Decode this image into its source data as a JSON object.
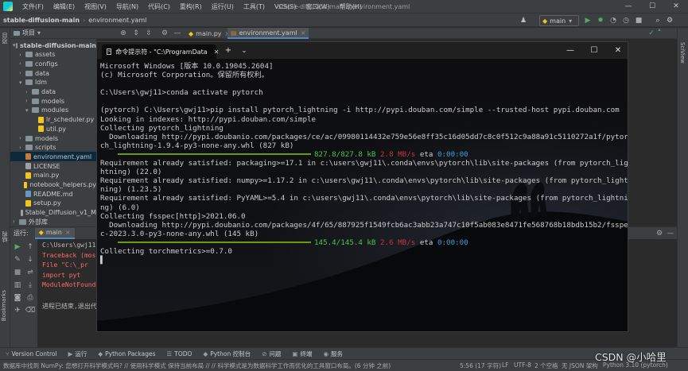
{
  "menubar": {
    "items": [
      "文件(F)",
      "编辑(E)",
      "视图(V)",
      "导航(N)",
      "代码(C)",
      "重构(R)",
      "运行(U)",
      "工具(T)",
      "VCS(S)",
      "窗口(W)",
      "帮助(H)"
    ],
    "window_title": "stable-diffusion-main - environment.yaml",
    "minimize": "—",
    "maximize": "☐",
    "close": "✕"
  },
  "navbar": {
    "project": "stable-diffusion-main",
    "file": "environment.yaml",
    "run_config": "main"
  },
  "tool_strips": {
    "project_tab": "项目",
    "structure_tab": "结构",
    "bookmarks_tab": "Bookmarks",
    "sciview_tab": "SciView"
  },
  "project_panel": {
    "header": "项目",
    "items": [
      {
        "label": "stable-diffusion-main",
        "kind": "root"
      },
      {
        "label": "assets",
        "kind": "folder"
      },
      {
        "label": "configs",
        "kind": "folder"
      },
      {
        "label": "data",
        "kind": "folder"
      },
      {
        "label": "ldm",
        "kind": "folder"
      },
      {
        "label": "data",
        "kind": "folder"
      },
      {
        "label": "models",
        "kind": "folder"
      },
      {
        "label": "modules",
        "kind": "folder"
      },
      {
        "label": "lr_scheduler.py",
        "kind": "py"
      },
      {
        "label": "util.py",
        "kind": "py"
      },
      {
        "label": "models",
        "kind": "folder"
      },
      {
        "label": "scripts",
        "kind": "folder"
      },
      {
        "label": "environment.yaml",
        "kind": "yaml"
      },
      {
        "label": "LICENSE",
        "kind": "txt"
      },
      {
        "label": "main.py",
        "kind": "py"
      },
      {
        "label": "notebook_helpers.py",
        "kind": "py"
      },
      {
        "label": "README.md",
        "kind": "md"
      },
      {
        "label": "setup.py",
        "kind": "py"
      },
      {
        "label": "Stable_Diffusion_v1_M",
        "kind": "txt"
      },
      {
        "label": "外部库",
        "kind": "lib"
      }
    ]
  },
  "editor_tabs": [
    {
      "label": "main.py"
    },
    {
      "label": "environment.yaml"
    }
  ],
  "run_panel": {
    "label": "运行:",
    "tab": "main",
    "lines": [
      {
        "text": "C:\\Users\\gwj11",
        "color": "#bbbbbb"
      },
      {
        "text": "Traceback (mos",
        "color": "#ff6b68"
      },
      {
        "text": "  File \"C:\\_pr",
        "color": "#ff6b68"
      },
      {
        "text": "    import pyt",
        "color": "#ff6b68"
      },
      {
        "text": "ModuleNotFoundE",
        "color": "#ff6b68"
      },
      {
        "text": "",
        "color": "#bbbbbb"
      },
      {
        "text": "进程已结束,退出代",
        "color": "#bbbbbb"
      }
    ]
  },
  "terminal": {
    "tab_title": "命令提示符 - \"C:\\ProgramData",
    "new_tab": "+",
    "dropdown": "⌄",
    "lines": [
      "Microsoft Windows [版本 10.0.19045.2604]",
      "(c) Microsoft Corporation。保留所有权利。",
      "",
      "C:\\Users\\gwj11>conda activate pytorch",
      "",
      "(pytorch) C:\\Users\\gwj11>pip install pytorch_lightning -i http://pypi.douban.com/simple --trusted-host pypi.douban.com",
      "Looking in indexes: http://pypi.douban.com/simple",
      "Collecting pytorch_lightning",
      "  Downloading http://pypi.doubanio.com/packages/ce/ac/09980114432e759e56e8ff35c16d05dd7c8c0f512c9a88a91c5110272a1f/pytor",
      "ch_lightning-1.9.4-py3-none-any.whl (827 kB)"
    ],
    "progress1": {
      "fraction": 1.0,
      "done": "827.8/827.8 kB",
      "speed": "2.8 MB/s",
      "eta_label": "eta",
      "eta": "0:00:00"
    },
    "lines2": [
      "Requirement already satisfied: packaging>=17.1 in c:\\users\\gwj11\\.conda\\envs\\pytorch\\lib\\site-packages (from pytorch_lig",
      "htning) (22.0)",
      "Requirement already satisfied: numpy>=1.17.2 in c:\\users\\gwj11\\.conda\\envs\\pytorch\\lib\\site-packages (from pytorch_light",
      "ning) (1.23.5)",
      "Requirement already satisfied: PyYAML>=5.4 in c:\\users\\gwj11\\.conda\\envs\\pytorch\\lib\\site-packages (from pytorch_lightni",
      "ng) (6.0)",
      "Collecting fsspec[http]>2021.06.0",
      "  Downloading http://pypi.doubanio.com/packages/4f/65/887925f1549fcb6ac3abb23a747c10f5ab083e8471fe568768b18bdb15b2/fsspe",
      "c-2023.3.0-py3-none-any.whl (145 kB)"
    ],
    "progress2": {
      "fraction": 1.0,
      "done": "145.4/145.4 kB",
      "speed": "2.6 MB/s",
      "eta_label": "eta",
      "eta": "0:00:00"
    },
    "lines3": [
      "Collecting torchmetrics>=0.7.0"
    ],
    "cursor": "▌"
  },
  "bottom_tools": [
    {
      "icon": "⑂",
      "label": "Version Control"
    },
    {
      "icon": "▶",
      "label": "运行"
    },
    {
      "icon": "◆",
      "label": "Python Packages"
    },
    {
      "icon": "☰",
      "label": "TODO"
    },
    {
      "icon": "◆",
      "label": "Python 控制台"
    },
    {
      "icon": "⊘",
      "label": "问题"
    },
    {
      "icon": "▣",
      "label": "终端"
    },
    {
      "icon": "◉",
      "label": "服务"
    }
  ],
  "statusbar": {
    "message": "数据库中找到 NumPy: 您想打开科学模式吗? // 使用科学模式   保持当前布局 // // 科学模式是为数据科学工作而优化的工具窗口布局。(6 分钟 之前)",
    "position": "5:56 (17 字符)",
    "line_sep": "LF",
    "encoding": "UTF-8",
    "indent": "2 个空格",
    "schema": "无 JSON 架构",
    "interpreter": "Python 3.10 (pytorch)"
  },
  "watermark": "CSDN @小哈里",
  "colors": {
    "ide_bg": "#2b2b2b",
    "panel_bg": "#3c3f41",
    "terminal_bg": "#0c0c0c",
    "progress_green": "#6a9a12",
    "speed_red": "#cc3333",
    "eta_cyan": "#3aa0d8",
    "error_red": "#ff6b68"
  }
}
